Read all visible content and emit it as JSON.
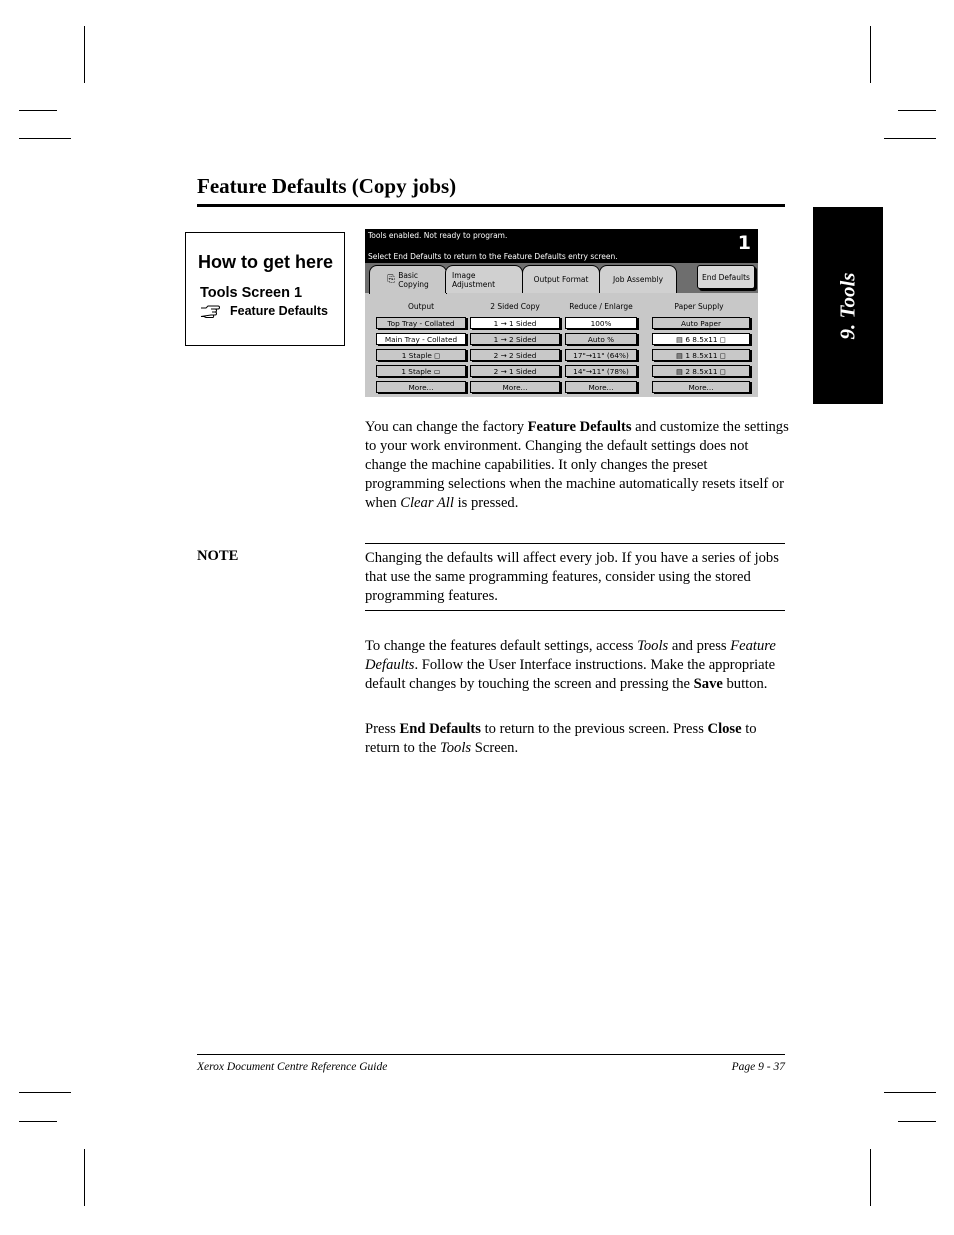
{
  "page": {
    "title": "Feature Defaults (Copy jobs)",
    "side_tab": "9. Tools"
  },
  "how_to": {
    "title": "How to get here",
    "screen": "Tools Screen 1",
    "link_icon": "pointing-hand-icon",
    "link": "Feature Defaults"
  },
  "ui_screen": {
    "message_line1": "Tools enabled.  Not ready to program.",
    "message_line2": "Select End Defaults to return to the Feature Defaults entry screen.",
    "screen_number": "1",
    "tabs": [
      {
        "line1": "Basic",
        "line2": "Copying",
        "icon": "copy-icon",
        "active": true
      },
      {
        "line1": "Image",
        "line2": "Adjustment",
        "active": false
      },
      {
        "line1": "Output Format",
        "line2": "",
        "active": false
      },
      {
        "line1": "Job Assembly",
        "line2": "",
        "active": false
      }
    ],
    "end_defaults_button": "End Defaults",
    "columns": [
      {
        "heading": "Output",
        "buttons": [
          {
            "label": "Top Tray - Collated",
            "selected": false
          },
          {
            "label": "Main Tray - Collated",
            "selected": true
          },
          {
            "label": "1 Staple ◻",
            "selected": false
          },
          {
            "label": "1 Staple ▭",
            "selected": false
          },
          {
            "label": "More...",
            "selected": false
          }
        ]
      },
      {
        "heading": "2 Sided Copy",
        "buttons": [
          {
            "label": "1 → 1 Sided",
            "selected": true
          },
          {
            "label": "1 → 2 Sided",
            "selected": false
          },
          {
            "label": "2 → 2 Sided",
            "selected": false
          },
          {
            "label": "2 → 1 Sided",
            "selected": false
          },
          {
            "label": "More...",
            "selected": false
          }
        ]
      },
      {
        "heading": "Reduce / Enlarge",
        "buttons": [
          {
            "label": "100%",
            "selected": true
          },
          {
            "label": "Auto %",
            "selected": false
          },
          {
            "label": "17\"→11\" (64%)",
            "selected": false
          },
          {
            "label": "14\"→11\" (78%)",
            "selected": false
          },
          {
            "label": "More...",
            "selected": false
          }
        ]
      },
      {
        "heading": "Paper Supply",
        "buttons": [
          {
            "label": "Auto Paper",
            "selected": false
          },
          {
            "label": "▤ 6  8.5x11 ◻",
            "selected": true
          },
          {
            "label": "▤ 1  8.5x11 ◻",
            "selected": false
          },
          {
            "label": "▤ 2  8.5x11 ◻",
            "selected": false
          },
          {
            "label": "More...",
            "selected": false
          }
        ]
      }
    ]
  },
  "body": {
    "para1": {
      "a": "You can change the factory ",
      "b_bold": "Feature Defaults",
      "c": " and customize the settings to your work environment. Changing the default settings does not change the machine capabilities. It only changes the preset programming selections when the machine automatically resets itself or when ",
      "d_italic": "Clear All",
      "e": " is pressed."
    },
    "note": {
      "label": "NOTE",
      "text": "Changing the defaults will affect every job. If you have a series of jobs that use the same programming features, consider using the stored programming features."
    },
    "para2": {
      "a": "To change the features default settings, access ",
      "b_italic": "Tools",
      "c": " and press ",
      "d_italic": "Feature Defaults",
      "e": ". Follow the User Interface instructions. Make the appropriate default changes by touching the screen and pressing the ",
      "f_bold": "Save",
      "g": " button."
    },
    "para3": {
      "a": "Press ",
      "b_bold": "End Defaults",
      "c": " to return to the previous screen. Press ",
      "d_bold": "Close",
      "e": " to return to the ",
      "f_italic": "Tools",
      "g": " Screen."
    }
  },
  "footer": {
    "left": "Xerox Document Centre Reference Guide",
    "right": "Page 9 - 37"
  }
}
